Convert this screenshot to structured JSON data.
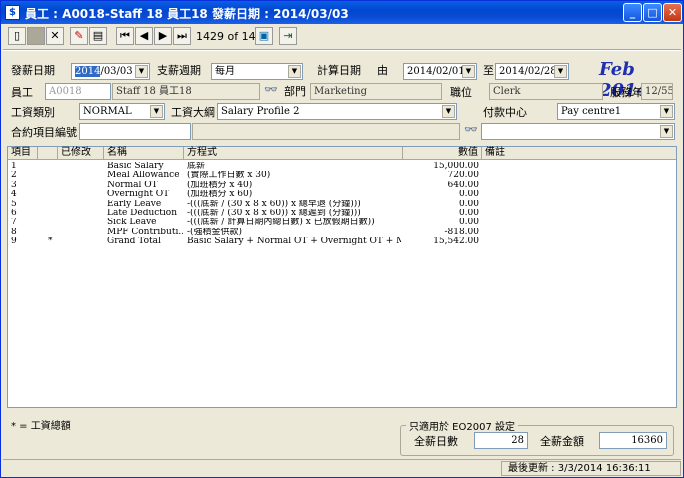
{
  "window": {
    "title": "員工 : A0018-Staff 18 員工18 發薪日期 : 2014/03/03",
    "app_icon": "$"
  },
  "toolbar": {
    "record_position": "1429 of 1432"
  },
  "form": {
    "pay_date_label": "發薪日期",
    "pay_date_year": "2014",
    "pay_date_rest": "/03/03",
    "pay_cycle_label": "支薪週期",
    "pay_cycle_value": "每月",
    "calc_date_label": "計算日期",
    "from_label": "由",
    "from_value": "2014/02/01",
    "to_label": "至",
    "to_value": "2014/02/28",
    "period_banner": "Feb 2014",
    "employee_label": "員工",
    "employee_code": "A0018",
    "employee_name": "Staff 18 員工18",
    "dept_label": "部門",
    "dept_value": "Marketing",
    "position_label": "職位",
    "position_value": "Clerk",
    "service_years_label": "服務年期",
    "service_years_value": "12/55",
    "pay_type_label": "工資類別",
    "pay_type_value": "NORMAL",
    "pay_outline_label": "工資大綱",
    "pay_outline_value": "Salary Profile 2",
    "pay_centre_label": "付款中心",
    "pay_centre_value": "Pay centre1",
    "contract_label": "合約項目編號"
  },
  "grid": {
    "headers": [
      "項目",
      "已修改",
      "名稱",
      "方程式",
      "數值",
      "備註"
    ],
    "rows": [
      {
        "item": "1",
        "mod": "",
        "name": "Basic Salary",
        "formula": "底薪",
        "value": "15,000.00"
      },
      {
        "item": "2",
        "mod": "",
        "name": "Meal Allowance",
        "formula": "(實際工作日數 x 30)",
        "value": "720.00"
      },
      {
        "item": "3",
        "mod": "",
        "name": "Normal OT",
        "formula": "(加班積分 x 40)",
        "value": "640.00"
      },
      {
        "item": "4",
        "mod": "",
        "name": "Overnight OT",
        "formula": "(加班積分 x 60)",
        "value": "0.00"
      },
      {
        "item": "5",
        "mod": "",
        "name": "Early Leave",
        "formula": "-(((底薪 / (30 x 8 x 60)) x 總早退 (分鐘)))",
        "value": "0.00"
      },
      {
        "item": "6",
        "mod": "",
        "name": "Late Deduction",
        "formula": "-(((底薪 / (30 x 8 x 60)) x 總遲到 (分鐘)))",
        "value": "0.00"
      },
      {
        "item": "7",
        "mod": "",
        "name": "Sick Leave",
        "formula": "-(((底薪 / 計算日期內總日數) x 已放假期日數))",
        "value": "0.00"
      },
      {
        "item": "8",
        "mod": "",
        "name": "MPF Contributi...",
        "formula": "-(強積金供款)",
        "value": "-818.00"
      },
      {
        "item": "9",
        "mod": "*",
        "name": "Grand Total",
        "formula": "Basic Salary + Normal OT + Overnight OT + Meal A...",
        "value": "15,542.00"
      }
    ]
  },
  "legend": "* = 工資總額",
  "eo2007": {
    "title": "只適用於 EO2007 設定",
    "full_days_label": "全薪日數",
    "full_days_value": "28",
    "full_amount_label": "全薪金額",
    "full_amount_value": "16360"
  },
  "status": {
    "last_update": "最後更新 : 3/3/2014 16:36:11"
  }
}
